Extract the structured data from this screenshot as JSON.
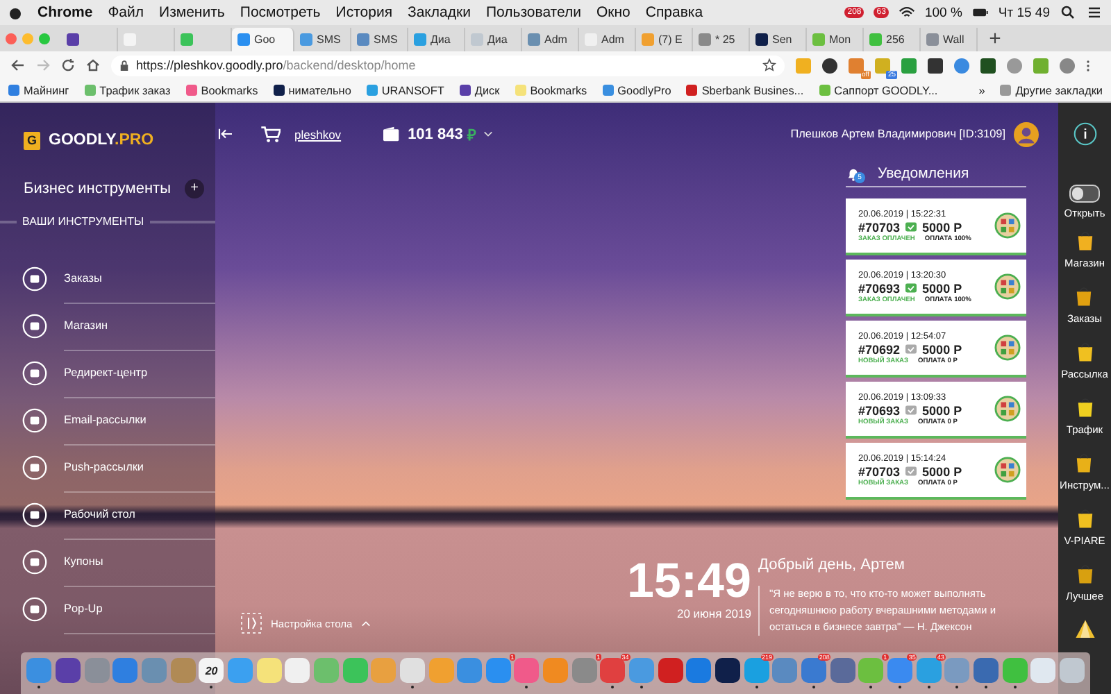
{
  "menu_bar": {
    "app": "Chrome",
    "items": [
      "Файл",
      "Изменить",
      "Посмотреть",
      "История",
      "Закладки",
      "Пользователи",
      "Окно",
      "Справка"
    ],
    "badges": [
      "208",
      "63"
    ],
    "battery": "100 %",
    "clock": "Чт 15 49"
  },
  "tabs": [
    {
      "selected": false
    },
    {
      "selected": false
    },
    {
      "selected": false
    },
    {
      "label": "Goo",
      "selected": true
    },
    {
      "label": "SMS",
      "selected": false
    },
    {
      "label": "SMS",
      "selected": false
    },
    {
      "label": "Диа",
      "selected": false
    },
    {
      "label": "Диа",
      "selected": false
    },
    {
      "label": "Adm",
      "selected": false
    },
    {
      "label": "Adm",
      "selected": false
    },
    {
      "label": "(7) E",
      "selected": false
    },
    {
      "label": "* 25",
      "selected": false
    },
    {
      "label": "Sen",
      "selected": false
    },
    {
      "label": "Mon",
      "selected": false
    },
    {
      "label": "256",
      "selected": false
    },
    {
      "label": "Wall",
      "selected": false
    }
  ],
  "address": {
    "host": "https://pleshkov.goodly.pro",
    "path": "/backend/desktop/home"
  },
  "extension_badges": [
    "off",
    "25"
  ],
  "bookmarks": [
    "Майнинг",
    "Трафик заказ",
    "Bookmarks",
    "нимательно",
    "URANSOFT",
    "Диск",
    "Bookmarks",
    "GoodlyPro",
    "Sberbank Busines...",
    "Саппорт GOODLY..."
  ],
  "bookmarks_more": "»",
  "other_bookmarks": "Другие закладки",
  "logo": {
    "mark": "G",
    "text": "GOODLY",
    "accent": ".PRO"
  },
  "sidebar": {
    "title": "Бизнес инструменты",
    "add": "+",
    "section": "ВАШИ ИНСТРУМЕНТЫ",
    "items": [
      "Заказы",
      "Магазин",
      "Редирект-центр",
      "Email-рассылки",
      "Push-рассылки",
      "Рабочий стол",
      "Купоны",
      "Pop-Up"
    ]
  },
  "header": {
    "username": "pleshkov",
    "balance": "101 843",
    "currency": "₽",
    "user": "Плешков Артем Владимирович [ID:3109]"
  },
  "notifications": {
    "title": "Уведомления",
    "count": "5",
    "items": [
      {
        "time": "20.06.2019 | 15:22:31",
        "order": "#70703",
        "amount": "5000 Р",
        "status": "ЗАКАЗ ОПЛАЧЕН",
        "payment": "ОПЛАТА 100%",
        "paid": true
      },
      {
        "time": "20.06.2019 | 13:20:30",
        "order": "#70693",
        "amount": "5000 Р",
        "status": "ЗАКАЗ ОПЛАЧЕН",
        "payment": "ОПЛАТА 100%",
        "paid": true
      },
      {
        "time": "20.06.2019 | 12:54:07",
        "order": "#70692",
        "amount": "5000 Р",
        "status": "НОВЫЙ ЗАКАЗ",
        "payment": "ОПЛАТА 0 Р",
        "paid": false
      },
      {
        "time": "20.06.2019 | 13:09:33",
        "order": "#70693",
        "amount": "5000 Р",
        "status": "НОВЫЙ ЗАКАЗ",
        "payment": "ОПЛАТА 0 Р",
        "paid": false
      },
      {
        "time": "20.06.2019 | 15:14:24",
        "order": "#70703",
        "amount": "5000 Р",
        "status": "НОВЫЙ ЗАКАЗ",
        "payment": "ОПЛАТА 0 Р",
        "paid": false
      }
    ]
  },
  "desk_settings": "Настройка стола",
  "clock": {
    "time": "15:49",
    "date": "20 июня 2019"
  },
  "greeting": "Добрый день, Артем",
  "quote": "\"Я не верю в то, что кто-то может выполнять сегодняшнюю работу вчерашними методами и остаться в бизнесе завтра\" — Н. Джексон",
  "right_bar": {
    "toggle_label": "Открыть",
    "toggle_on": false,
    "items": [
      "Магазин",
      "Заказы",
      "Рассылка",
      "Трафик",
      "Инструм...",
      "V-PIARE",
      "Лучшее"
    ]
  },
  "dock": [
    {
      "running": true
    },
    {
      "running": false
    },
    {
      "running": false
    },
    {
      "running": false
    },
    {
      "running": false
    },
    {
      "running": false
    },
    {
      "running": true,
      "label": "20"
    },
    {
      "running": false
    },
    {
      "running": false
    },
    {
      "running": false
    },
    {
      "running": false
    },
    {
      "running": false
    },
    {
      "running": false
    },
    {
      "running": true
    },
    {
      "running": false
    },
    {
      "running": false
    },
    {
      "badge": "1",
      "running": false
    },
    {
      "running": true
    },
    {
      "running": false
    },
    {
      "badge": "1",
      "running": false
    },
    {
      "badge": "34",
      "running": true
    },
    {
      "running": true
    },
    {
      "running": false
    },
    {
      "running": false
    },
    {
      "running": false
    },
    {
      "badge": "219",
      "running": true
    },
    {
      "running": false
    },
    {
      "badge": "208",
      "running": true
    },
    {
      "running": false
    },
    {
      "badge": "1",
      "running": true
    },
    {
      "badge": "35",
      "running": true
    },
    {
      "badge": "43",
      "running": true
    },
    {
      "running": true
    },
    {
      "running": true
    },
    {
      "running": true
    },
    {
      "running": false
    },
    {
      "running": false
    }
  ]
}
